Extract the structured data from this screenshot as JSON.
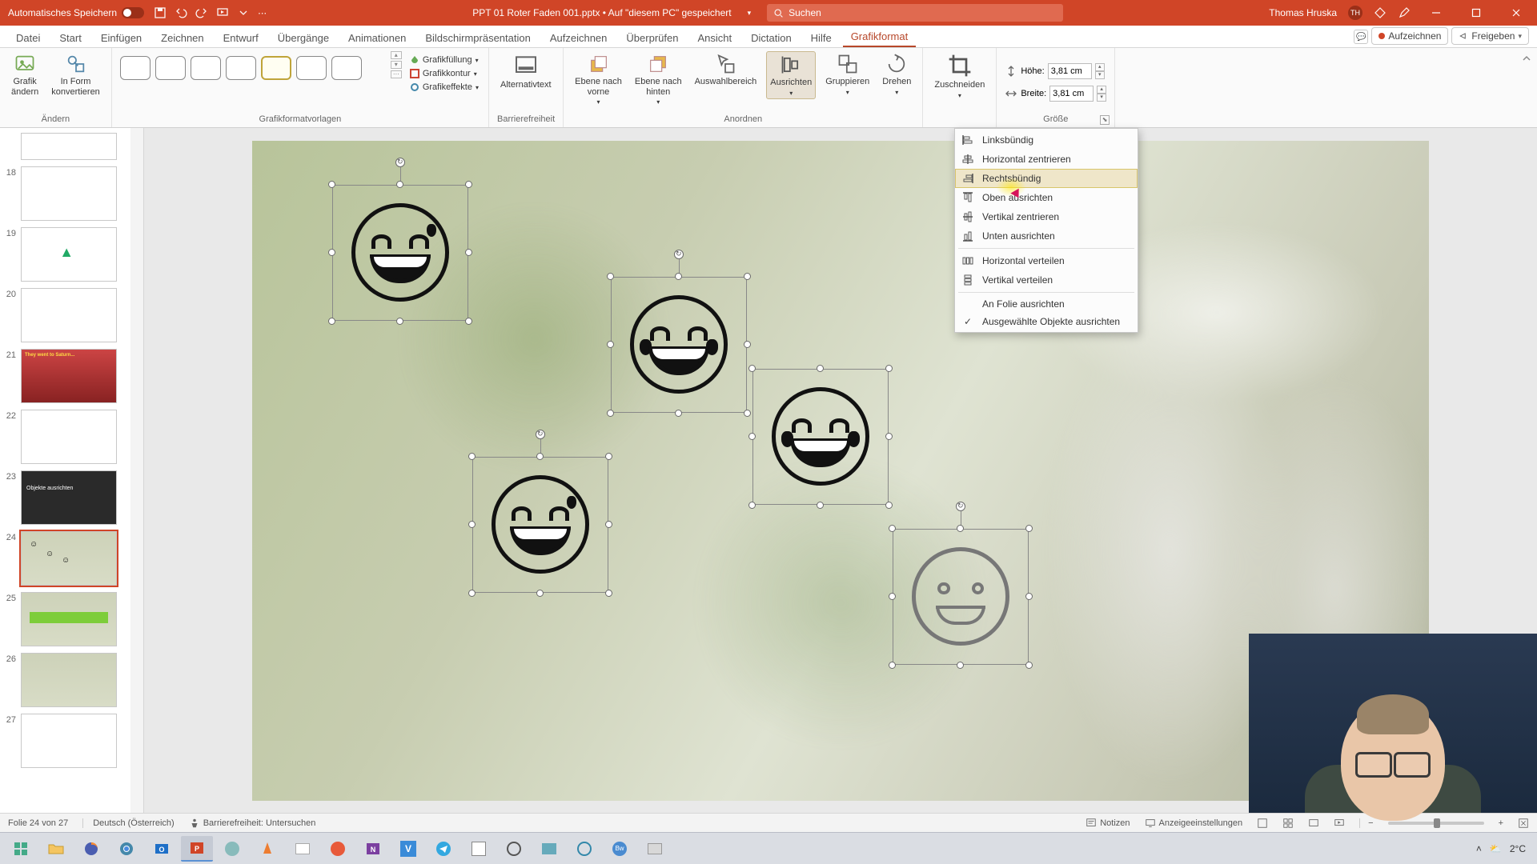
{
  "titlebar": {
    "autosave_label": "Automatisches Speichern",
    "doc_title": "PPT 01 Roter Faden 001.pptx • Auf \"diesem PC\" gespeichert",
    "search_placeholder": "Suchen",
    "user_name": "Thomas Hruska",
    "user_initials": "TH"
  },
  "tabs": {
    "items": [
      "Datei",
      "Start",
      "Einfügen",
      "Zeichnen",
      "Entwurf",
      "Übergänge",
      "Animationen",
      "Bildschirmpräsentation",
      "Aufzeichnen",
      "Überprüfen",
      "Ansicht",
      "Dictation",
      "Hilfe",
      "Grafikformat"
    ],
    "active_index": 13,
    "record_btn": "Aufzeichnen",
    "share_btn": "Freigeben"
  },
  "ribbon": {
    "aendern": {
      "label": "Ändern",
      "btn1": "Grafik\nändern",
      "btn2": "In Form\nkonvertieren"
    },
    "vorlagen": {
      "label": "Grafikformatvorlagen",
      "fill": "Grafikfüllung",
      "outline": "Grafikkontur",
      "effects": "Grafikeffekte"
    },
    "barrierefreiheit": {
      "label": "Barrierefreiheit",
      "alt": "Alternativtext"
    },
    "anordnen": {
      "label": "Anordnen",
      "vorne": "Ebene nach\nvorne",
      "hinten": "Ebene nach\nhinten",
      "auswahl": "Auswahlbereich",
      "ausrichten": "Ausrichten",
      "gruppieren": "Gruppieren",
      "drehen": "Drehen"
    },
    "zuschneiden": {
      "btn": "Zuschneiden"
    },
    "groesse": {
      "label": "Größe",
      "hoehe_lbl": "Höhe:",
      "hoehe_val": "3,81 cm",
      "breite_lbl": "Breite:",
      "breite_val": "3,81 cm"
    }
  },
  "align_menu": {
    "items": [
      {
        "label": "Linksbündig",
        "icon": "align-left"
      },
      {
        "label": "Horizontal zentrieren",
        "icon": "align-center-h"
      },
      {
        "label": "Rechtsbündig",
        "icon": "align-right",
        "hover": true
      },
      {
        "label": "Oben ausrichten",
        "icon": "align-top"
      },
      {
        "label": "Vertikal zentrieren",
        "icon": "align-center-v"
      },
      {
        "label": "Unten ausrichten",
        "icon": "align-bottom"
      }
    ],
    "dist": [
      {
        "label": "Horizontal verteilen",
        "icon": "dist-h"
      },
      {
        "label": "Vertikal verteilen",
        "icon": "dist-v"
      }
    ],
    "opts": [
      {
        "label": "An Folie ausrichten",
        "checked": false
      },
      {
        "label": "Ausgewählte Objekte ausrichten",
        "checked": true
      }
    ]
  },
  "thumbs": {
    "numbers": [
      "",
      "18",
      "19",
      "20",
      "21",
      "22",
      "23",
      "24",
      "25",
      "26",
      "27"
    ],
    "selected_index": 7
  },
  "status": {
    "slide_info": "Folie 24 von 27",
    "language": "Deutsch (Österreich)",
    "access": "Barrierefreiheit: Untersuchen",
    "notes": "Notizen",
    "display": "Anzeigeeinstellungen"
  },
  "taskbar": {
    "weather": "2°C"
  }
}
